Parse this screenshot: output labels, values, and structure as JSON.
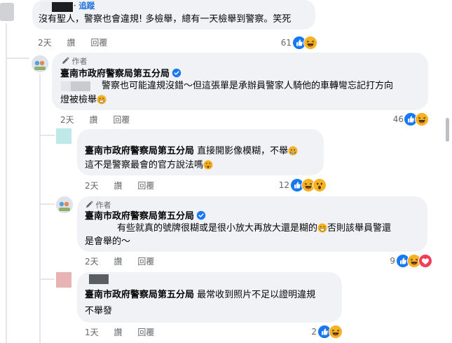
{
  "comment1": {
    "follow_label": "追蹤",
    "text": "沒有聖人，警察也會違規! 多檢舉，總有一天檢舉到警察。笑死",
    "time": "2天",
    "like": "讚",
    "reply": "回覆",
    "reactions": "61"
  },
  "comment2": {
    "author_badge": "作者",
    "name": "臺南市政府警察局第五分局",
    "text_line1": "警察也可能違規沒錯～但這張單是承辦員警家人騎他的車轉彎忘記打方向",
    "text_line2": "燈被檢舉",
    "time": "2天",
    "like": "讚",
    "reply": "回覆",
    "reactions": "46"
  },
  "comment3": {
    "name": "臺南市政府警察局第五分局",
    "text_line1": "直接開影像模糊，不舉",
    "text_line2": "這不是警察最會的官方說法嗎",
    "time": "2天",
    "like": "讚",
    "reply": "回覆",
    "reactions": "12"
  },
  "comment4": {
    "author_badge": "作者",
    "name": "臺南市政府警察局第五分局",
    "text_line1": "有些就真的號牌很糊或是很小放大再放大還是糊的",
    "text_line1b": "否則該舉員警還",
    "text_line2": "是會舉的～",
    "time": "2天",
    "like": "讚",
    "reply": "回覆",
    "reactions": "9"
  },
  "comment5": {
    "name": "臺南市政府警察局第五分局",
    "text_line1": "最常收到照片不足以證明違規",
    "text_line2": "不舉發",
    "time": "1天",
    "like": "讚",
    "reply": "回覆",
    "reactions": "2"
  },
  "colors": {
    "bubble": "#f0f2f5",
    "link": "#216fdb",
    "meta": "#65676b",
    "like_blue": "#1877f2",
    "haha_yellow": "#f7b125",
    "love_red": "#f33e58"
  }
}
